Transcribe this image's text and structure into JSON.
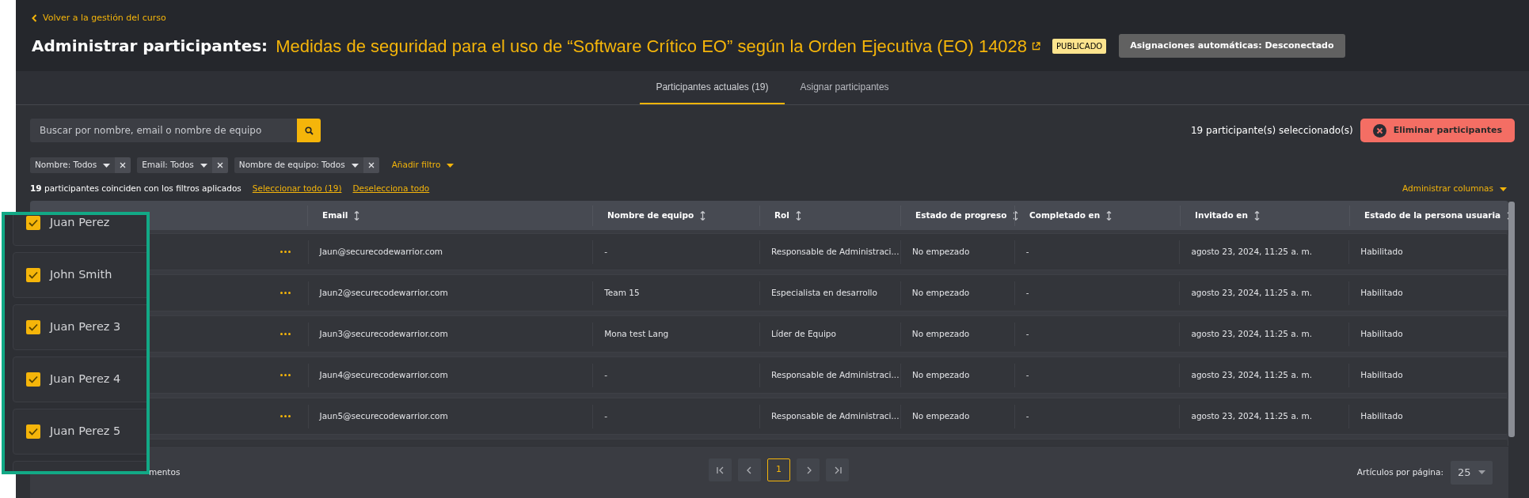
{
  "back_link": "Volver a la gestión del curso",
  "header": {
    "title": "Administrar participantes:",
    "course_title": "Medidas de seguridad para el uso de “Software Crítico EO” según la Orden Ejecutiva (EO) 14028",
    "status_badge": "PUBLICADO",
    "auto_assign_button": "Asignaciones automáticas: Desconectado"
  },
  "tabs": [
    {
      "label": "Participantes actuales (19)",
      "selected": true
    },
    {
      "label": "Asignar participantes",
      "selected": false
    }
  ],
  "search": {
    "placeholder": "Buscar por nombre, email o nombre de equipo"
  },
  "selection_count": "19 participante(s) seleccionado(s)",
  "delete_button": "Eliminar participantes",
  "filters": [
    {
      "label": "Nombre: Todos"
    },
    {
      "label": "Email: Todos"
    },
    {
      "label": "Nombre de equipo: Todos"
    }
  ],
  "add_filter": "Añadir filtro",
  "match_summary": "**19** participantes coinciden con los filtros aplicados",
  "select_all": "Seleccionar todo (19)",
  "deselect_all": "Deselecciona todo",
  "manage_columns": "Administrar columnas",
  "table": {
    "columns": [
      "Email",
      "Nombre de equipo",
      "Rol",
      "Estado de progreso",
      "Completado en",
      "Invitado en",
      "Estado de la persona usuaria"
    ],
    "rows": [
      {
        "cells": [
          "Jaun@securecodewarrior.com",
          "-",
          "Responsable de Administraci...",
          "No empezado",
          "-",
          "agosto 23, 2024, 11:25 a. m.",
          "Habilitado"
        ]
      },
      {
        "cells": [
          "Jaun2@securecodewarrior.com",
          "Team 15",
          "Especialista en desarrollo",
          "No empezado",
          "-",
          "agosto 23, 2024, 11:25 a. m.",
          "Habilitado"
        ]
      },
      {
        "cells": [
          "Jaun3@securecodewarrior.com",
          "Mona test Lang",
          "Líder de Equipo",
          "No empezado",
          "-",
          "agosto 23, 2024, 11:25 a. m.",
          "Habilitado"
        ]
      },
      {
        "cells": [
          "Jaun4@securecodewarrior.com",
          "-",
          "Responsable de Administraci...",
          "No empezado",
          "-",
          "agosto 23, 2024, 11:25 a. m.",
          "Habilitado"
        ]
      },
      {
        "cells": [
          "Jaun5@securecodewarrior.com",
          "-",
          "Responsable de Administraci...",
          "No empezado",
          "-",
          "agosto 23, 2024, 11:25 a. m.",
          "Habilitado"
        ]
      }
    ]
  },
  "footer": {
    "summary": "mentos",
    "pages": [
      {
        "label": "1",
        "selected": true
      }
    ],
    "page_size_label": "Artículos por página:",
    "page_size": "25"
  },
  "callout": {
    "items": [
      {
        "name": "Juan Perez",
        "checked": true
      },
      {
        "name": "John Smith",
        "checked": true
      },
      {
        "name": "Juan Perez 3",
        "checked": true
      },
      {
        "name": "Juan Perez 4",
        "checked": true
      },
      {
        "name": "Juan Perez 5",
        "checked": true
      }
    ]
  }
}
